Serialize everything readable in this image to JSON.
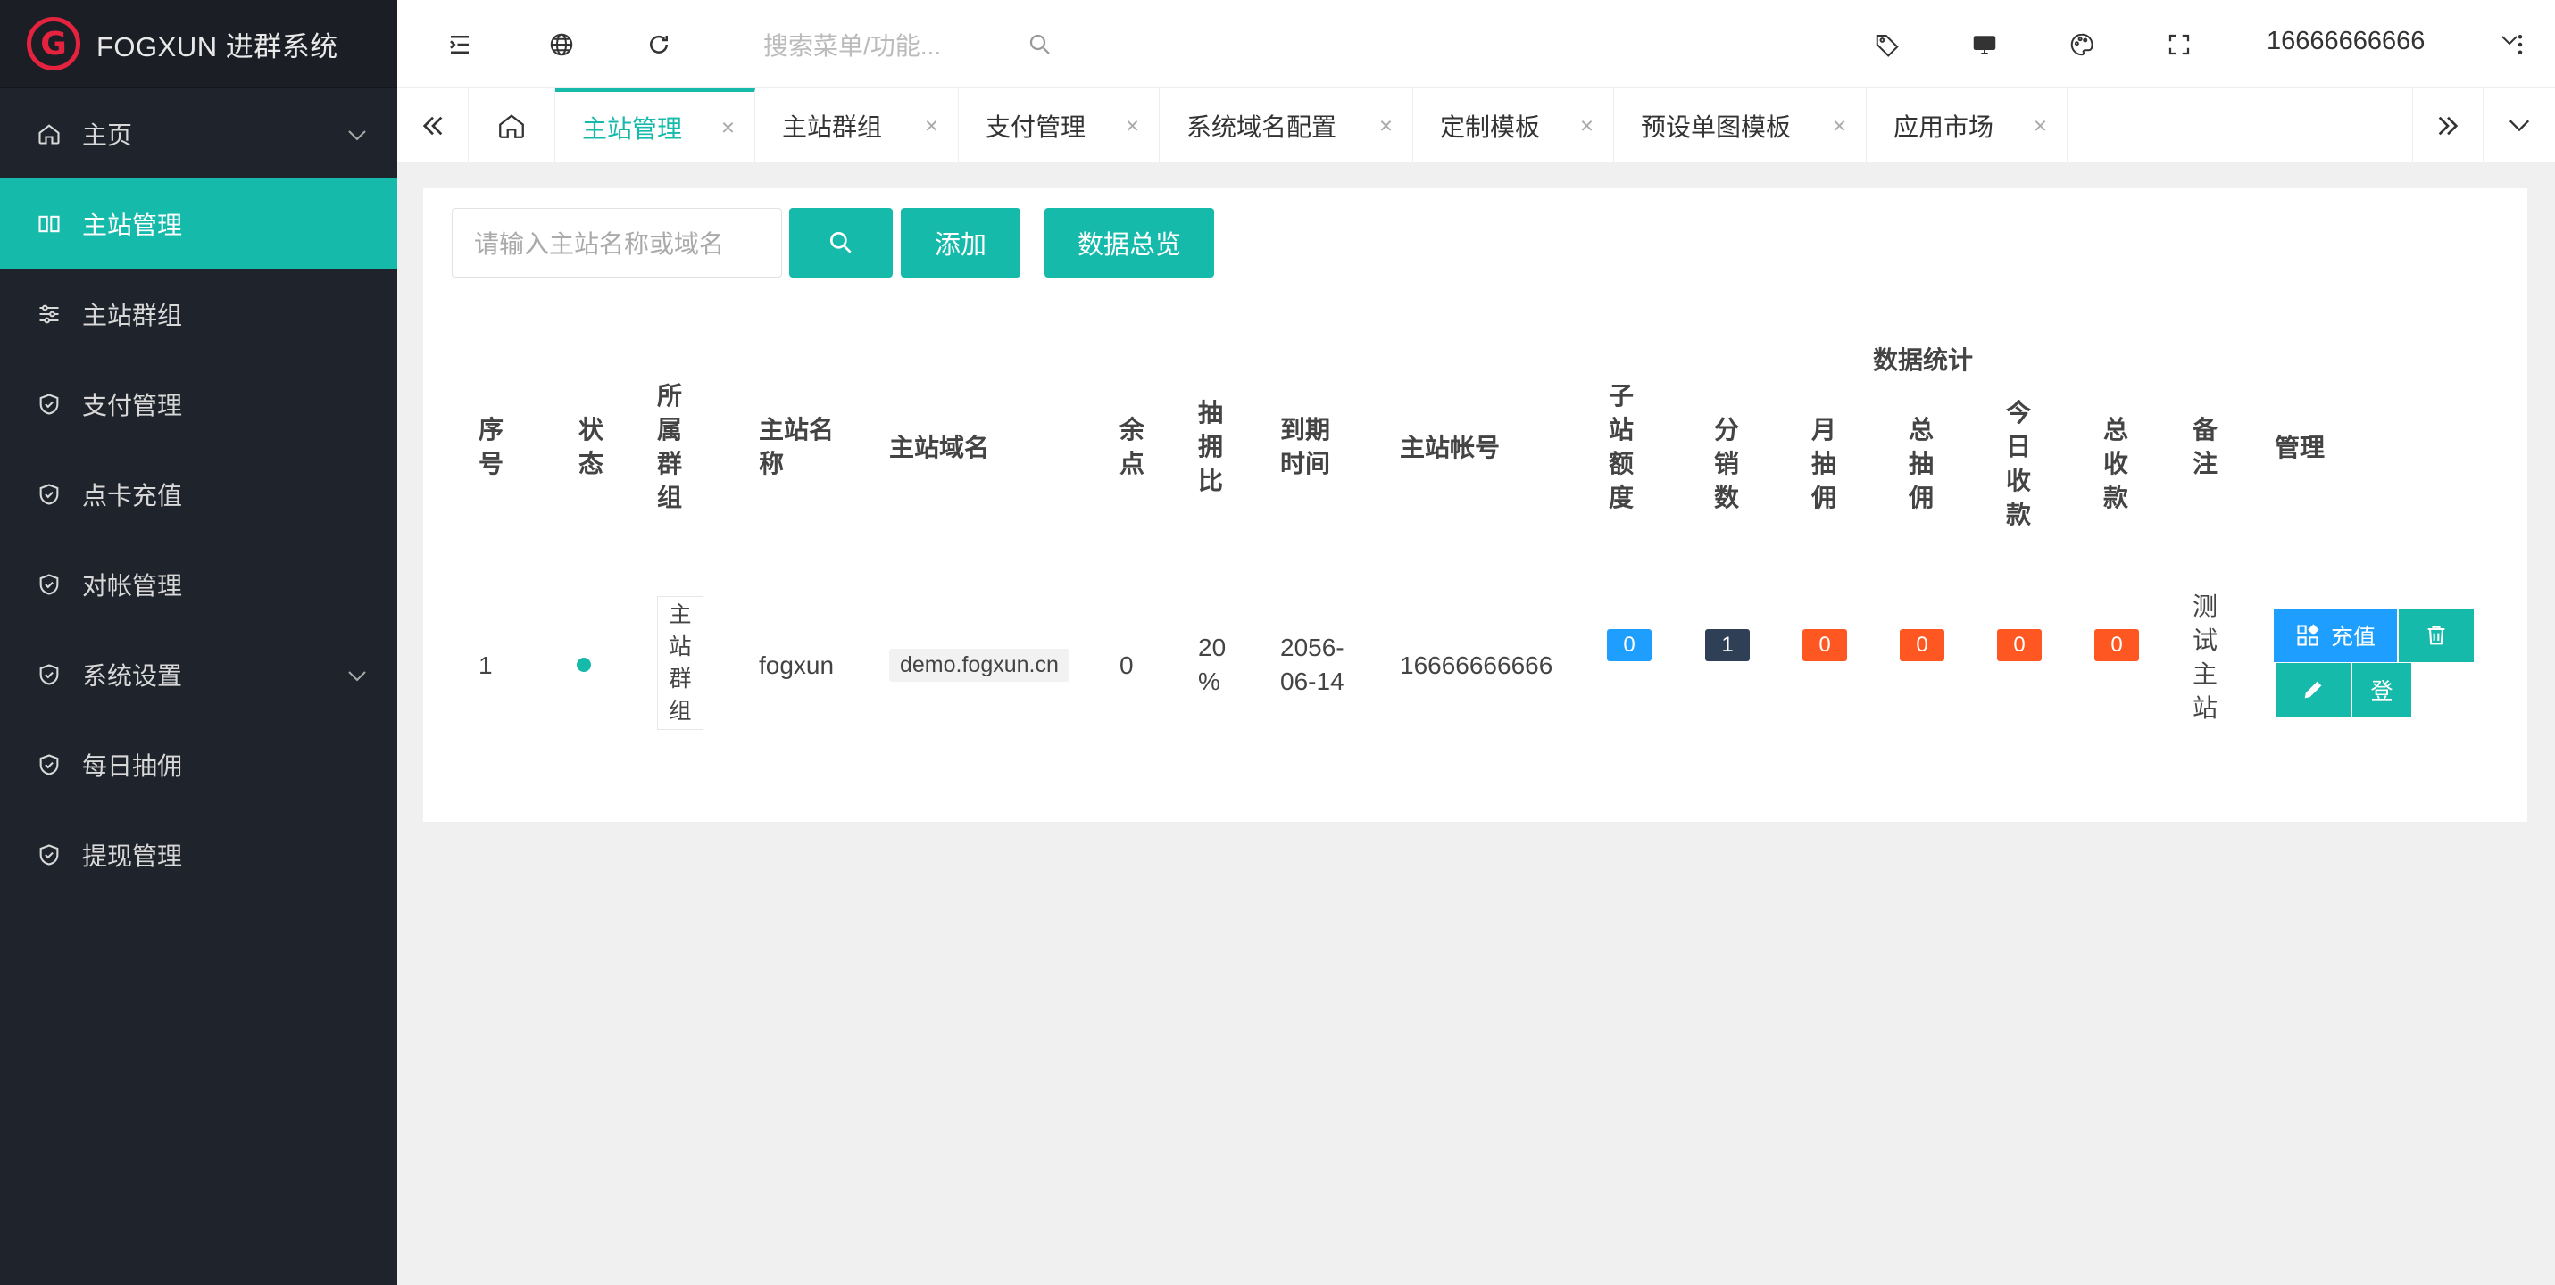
{
  "app": {
    "logo_letter": "G",
    "title": "FOGXUN 进群系统"
  },
  "sidebar": {
    "items": [
      {
        "label": "主页",
        "icon": "home-icon",
        "expandable": true
      },
      {
        "label": "主站管理",
        "icon": "columns-icon",
        "active": true
      },
      {
        "label": "主站群组",
        "icon": "sliders-icon"
      },
      {
        "label": "支付管理",
        "icon": "shield-check-icon"
      },
      {
        "label": "点卡充值",
        "icon": "shield-check-icon"
      },
      {
        "label": "对帐管理",
        "icon": "shield-check-icon"
      },
      {
        "label": "系统设置",
        "icon": "shield-check-icon",
        "expandable": true
      },
      {
        "label": "每日抽佣",
        "icon": "shield-check-icon"
      },
      {
        "label": "提现管理",
        "icon": "shield-check-icon"
      }
    ]
  },
  "header": {
    "search_placeholder": "搜索菜单/功能...",
    "user": "16666666666"
  },
  "tabs": {
    "items": [
      {
        "label": "主站管理",
        "active": true
      },
      {
        "label": "主站群组"
      },
      {
        "label": "支付管理"
      },
      {
        "label": "系统域名配置"
      },
      {
        "label": "定制模板"
      },
      {
        "label": "预设单图模板"
      },
      {
        "label": "应用市场"
      }
    ],
    "close_glyph": "×"
  },
  "toolbar": {
    "search_placeholder": "请输入主站名称或域名",
    "add_label": "添加",
    "overview_label": "数据总览"
  },
  "table": {
    "group_header": "数据统计",
    "headers": {
      "seq": "序号",
      "status": "状态",
      "group": "所属群组",
      "name": "主站名称",
      "domain": "主站域名",
      "balance": "余点",
      "ratio": "抽拥比",
      "expire": "到期时间",
      "account": "主站帐号",
      "quota": "子站额度",
      "distributors": "分销数",
      "monthly": "月抽佣",
      "total_comm": "总抽佣",
      "today_income": "今日收款",
      "total_income": "总收款",
      "remark": "备注",
      "manage": "管理"
    },
    "rows": [
      {
        "seq": "1",
        "group": "主站群组",
        "name": "fogxun",
        "domain": "demo.fogxun.cn",
        "balance": "0",
        "ratio": "20 %",
        "expire": "2056-06-14",
        "account": "16666666666",
        "quota": "0",
        "distributors": "1",
        "monthly": "0",
        "total_comm": "0",
        "today_income": "0",
        "total_income": "0",
        "remark": "测试主站"
      }
    ],
    "actions": {
      "recharge": "充值",
      "login": "登"
    }
  },
  "colors": {
    "primary": "#16baaa",
    "blue": "#1e9fff",
    "dark": "#2f4056",
    "orange": "#ff5722",
    "sidebar": "#1f232b"
  }
}
